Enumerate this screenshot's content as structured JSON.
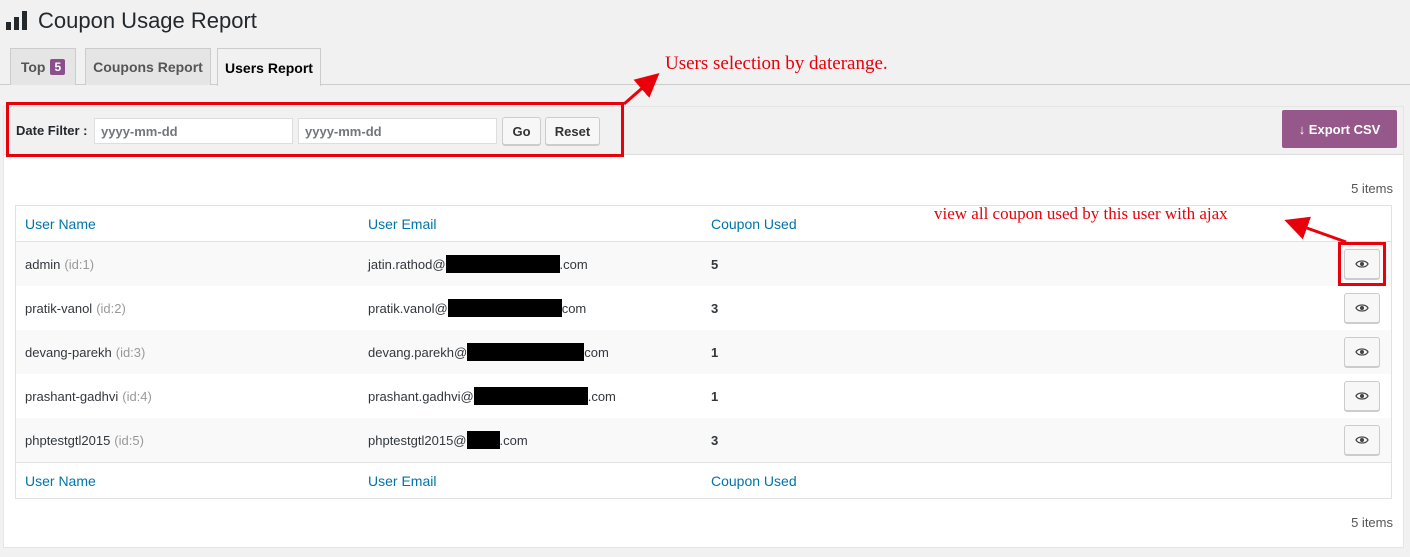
{
  "page": {
    "title": "Coupon Usage Report"
  },
  "tabs": [
    {
      "label": "Top",
      "badge": "5"
    },
    {
      "label": "Coupons Report"
    },
    {
      "label": "Users Report"
    }
  ],
  "filter": {
    "label": "Date Filter :",
    "start_placeholder": "yyyy-mm-dd",
    "end_placeholder": "yyyy-mm-dd",
    "go_label": "Go",
    "reset_label": "Reset"
  },
  "export": {
    "icon": "arrow-down-icon",
    "label": "↓ Export CSV"
  },
  "items_count": "5 items",
  "table": {
    "columns": [
      "User Name",
      "User Email",
      "Coupon Used"
    ],
    "rows": [
      {
        "name": "admin",
        "id": "(id:1)",
        "email_prefix": "jatin.rathod@",
        "email_suffix": ".com",
        "count": "5"
      },
      {
        "name": "pratik-vanol",
        "id": "(id:2)",
        "email_prefix": "pratik.vanol@",
        "email_suffix": "com",
        "count": "3"
      },
      {
        "name": "devang-parekh",
        "id": "(id:3)",
        "email_prefix": "devang.parekh@",
        "email_suffix": "com",
        "count": "1"
      },
      {
        "name": "prashant-gadhvi",
        "id": "(id:4)",
        "email_prefix": "prashant.gadhvi@",
        "email_suffix": ".com",
        "count": "1"
      },
      {
        "name": "phptestgtl2015",
        "id": "(id:5)",
        "email_prefix": "phptestgtl2015@",
        "email_suffix": ".com",
        "count": "3"
      }
    ],
    "row_action_icon": "eye-icon"
  },
  "annotations": {
    "daterange_note": "Users selection by daterange.",
    "ajax_note": "view all coupon used by this user with ajax",
    "color": "#e8000b"
  },
  "colors": {
    "accent": "#96588a",
    "badge": "#8b4f8c",
    "link": "#0073aa"
  }
}
